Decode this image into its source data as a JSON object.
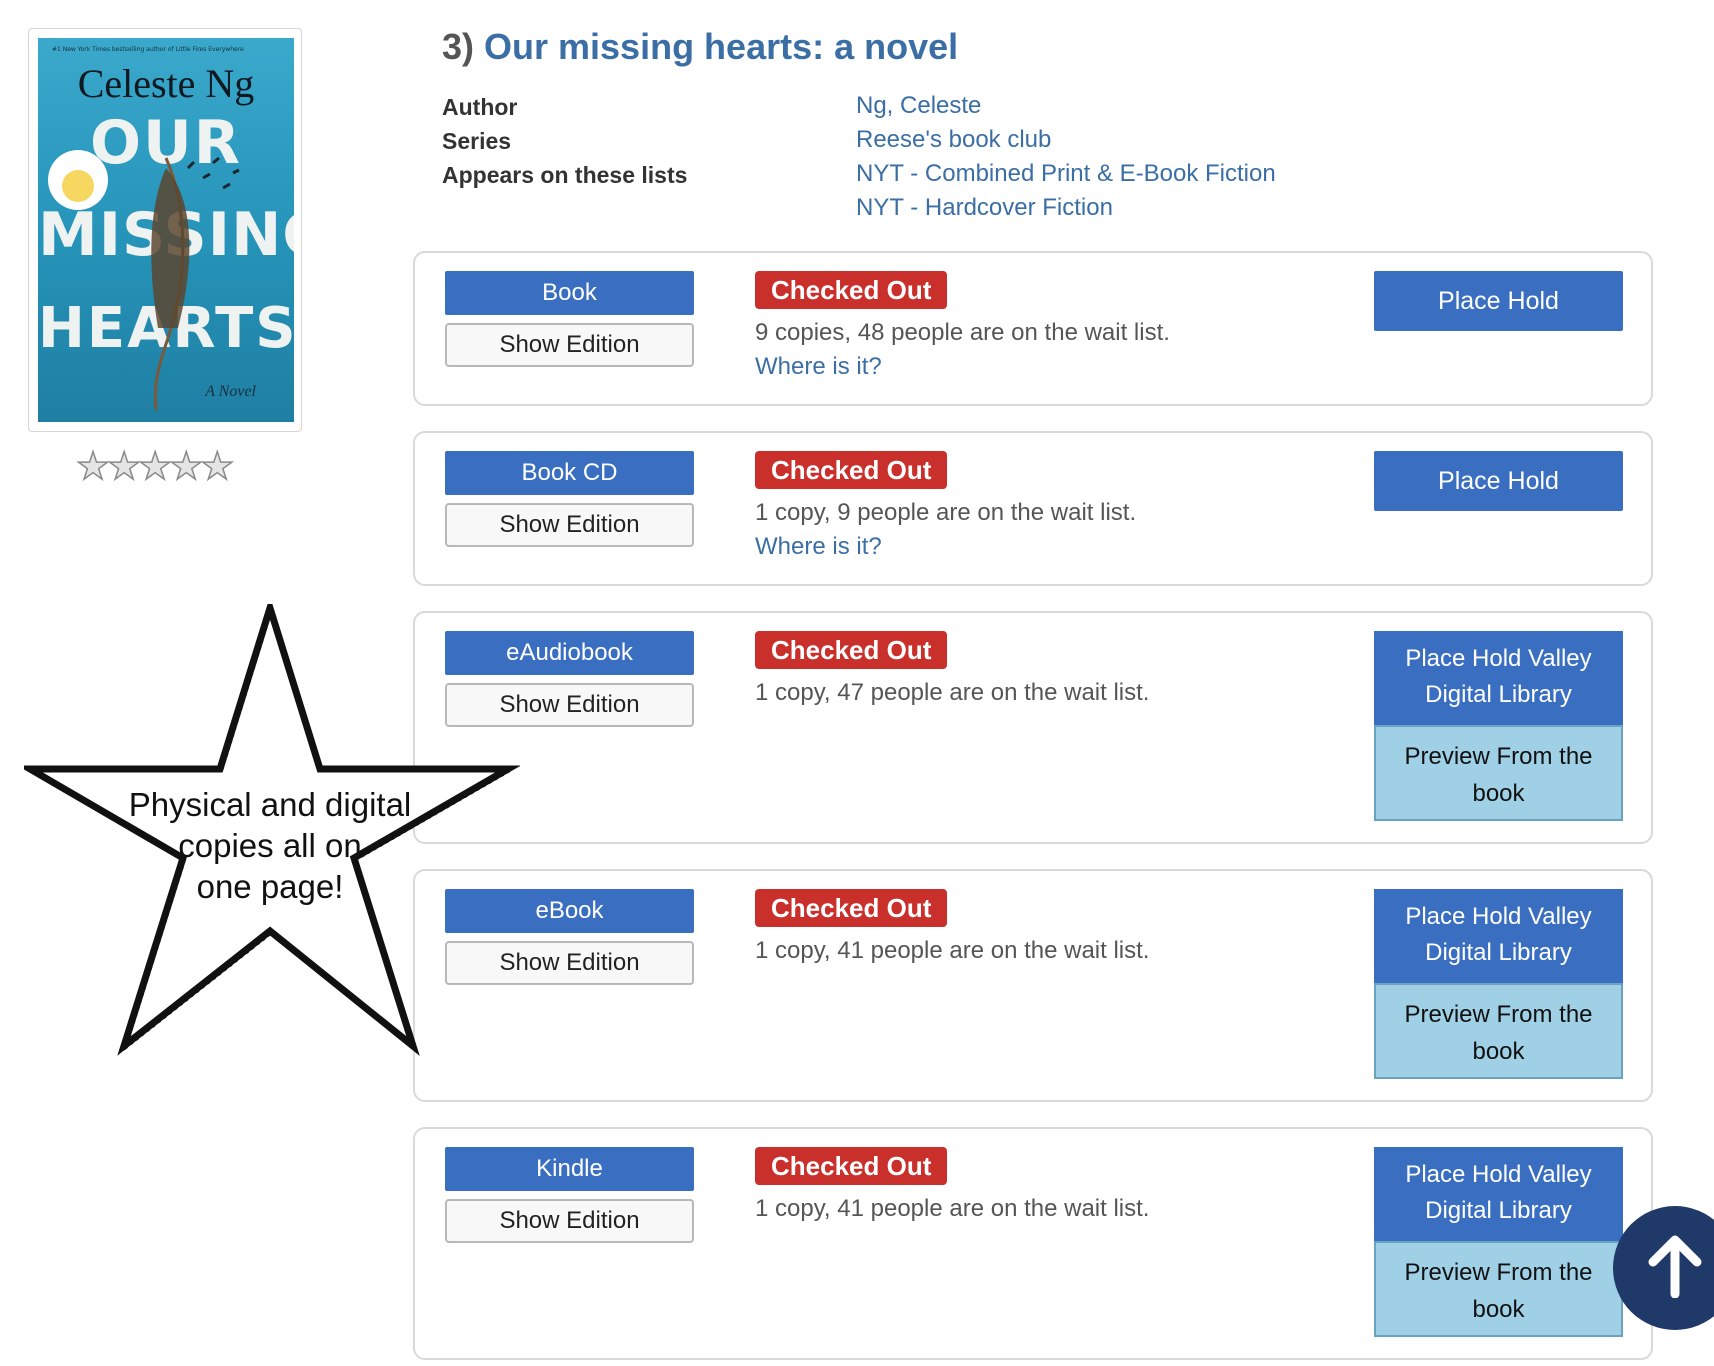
{
  "cover": {
    "author_text": "Celeste Ng",
    "title_lines": [
      "OUR",
      "MISSING",
      "HEARTS"
    ],
    "subtitle": "A Novel",
    "tagline": "#1 New York Times bestselling author of Little Fires Everywhere",
    "background_color": "#2a9bbf"
  },
  "rating": {
    "stars": "★★★★★",
    "filled": 0,
    "max": 5
  },
  "record": {
    "number": "3)",
    "title": "Our missing hearts: a novel",
    "author_label": "Author",
    "author_value": "Ng, Celeste",
    "series_label": "Series",
    "series_value": "Reese's book club",
    "lists_label": "Appears on these lists",
    "lists": [
      "NYT - Combined Print & E-Book Fiction",
      "NYT - Hardcover Fiction"
    ]
  },
  "formats": [
    {
      "format": "Book",
      "edition_button": "Show Edition",
      "status": "Checked Out",
      "copies_text": "9 copies, 48 people are on the wait list.",
      "where_link": "Where is it?",
      "hold_label": "Place Hold"
    },
    {
      "format": "Book CD",
      "edition_button": "Show Edition",
      "status": "Checked Out",
      "copies_text": "1 copy, 9 people are on the wait list.",
      "where_link": "Where is it?",
      "hold_label": "Place Hold"
    },
    {
      "format": "eAudiobook",
      "edition_button": "Show Edition",
      "status": "Checked Out",
      "copies_text": "1 copy, 47 people are on the wait list.",
      "hold_line1": "Place Hold Valley",
      "hold_line2": "Digital Library",
      "preview_line1": "Preview From the",
      "preview_line2": "book"
    },
    {
      "format": "eBook",
      "edition_button": "Show Edition",
      "status": "Checked Out",
      "copies_text": "1 copy, 41 people are on the wait list.",
      "hold_line1": "Place Hold Valley",
      "hold_line2": "Digital Library",
      "preview_line1": "Preview From the",
      "preview_line2": "book"
    },
    {
      "format": "Kindle",
      "edition_button": "Show Edition",
      "status": "Checked Out",
      "copies_text": "1 copy, 41 people are on the wait list.",
      "hold_line1": "Place Hold Valley",
      "hold_line2": "Digital Library",
      "preview_line1": "Preview From the",
      "preview_line2": "book"
    }
  ],
  "annotation": {
    "line1": "Physical and digital",
    "line2": "copies all on",
    "line3": "one page!"
  },
  "scroll_top": {
    "icon": "arrow-up-icon"
  },
  "colors": {
    "link": "#3a6ea5",
    "button": "#3a6ec1",
    "status": "#c9302c",
    "preview": "#9fd0e6",
    "scroll_top": "#1f3a68"
  }
}
